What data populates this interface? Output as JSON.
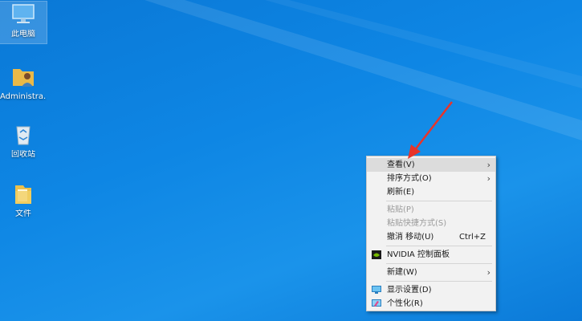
{
  "desktop": {
    "icons": [
      {
        "label": "此电脑",
        "icon": "computer-icon"
      },
      {
        "label": "Administra...",
        "icon": "user-folder-icon"
      },
      {
        "label": "回收站",
        "icon": "recycle-bin-icon"
      },
      {
        "label": "文件",
        "icon": "folder-icon"
      }
    ]
  },
  "context_menu": {
    "items": [
      {
        "label": "查看(V)"
      },
      {
        "label": "排序方式(O)"
      },
      {
        "label": "刷新(E)"
      },
      {
        "label": "粘贴(P)"
      },
      {
        "label": "粘贴快捷方式(S)"
      },
      {
        "label": "撤消 移动(U)",
        "shortcut": "Ctrl+Z"
      },
      {
        "label": "NVIDIA 控制面板"
      },
      {
        "label": "新建(W)"
      },
      {
        "label": "显示设置(D)"
      },
      {
        "label": "个性化(R)"
      }
    ]
  },
  "colors": {
    "desktop_bg": "#0e86e4",
    "annotation_arrow": "#e8342a",
    "menu_bg": "#f2f2f2",
    "nvidia_green": "#76b900"
  }
}
